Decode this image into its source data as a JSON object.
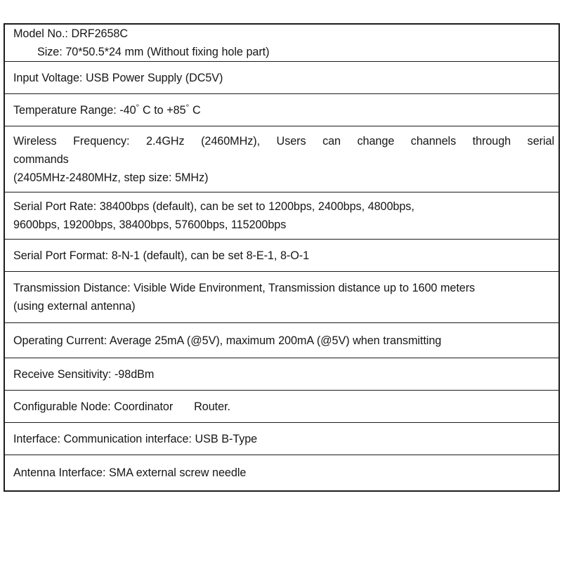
{
  "document": {
    "type": "specification-table",
    "title": "Wireless Module Specification",
    "background_color": "#ffffff",
    "text_color": "#161616",
    "border_color": "#1c1c1c",
    "row_count": 12
  },
  "table": {
    "rows": [
      {
        "key": "model-no",
        "label": "Model No.:",
        "value": "DRF2658C",
        "label2": "Size:",
        "value2": "70*50.5*24 mm (Without fixing hole part)",
        "line1_a": "Model No.: DRF2658C",
        "line1_b": "Size: 70*50.5*24 mm (Without fixing hole part)",
        "full_text": "Model No.: DRF2658C      Size: 70*50.5*24 mm (Without fixing hole part)"
      },
      {
        "key": "input-voltage",
        "label": "Input Voltage:",
        "value": "USB Power Supply (DC5V)",
        "line1": "Input Voltage: USB Power Supply (DC5V)",
        "full_text": "Input Voltage: USB Power Supply (DC5V)"
      },
      {
        "key": "temperature-range",
        "label": "Temperature Range:",
        "value": "-40° C to +85° C",
        "seg_a": "Temperature Range: -40",
        "seg_b": " C to +85",
        "seg_c": " C",
        "degree_symbol": "°",
        "full_text": "Temperature Range: -40° C to +85° C"
      },
      {
        "key": "wireless-frequency",
        "label": "Wireless Frequency:",
        "value": "2.4GHz (2460MHz), Users can change channels through serial commands (2405MHz-2480MHz, step size: 5MHz)",
        "line1": "Wireless Frequency: 2.4GHz (2460MHz), Users can change channels through serial",
        "line2": "commands",
        "line3": "(2405MHz-2480MHz, step size: 5MHz)",
        "full_text": "Wireless Frequency: 2.4GHz (2460MHz), Users can change channels through serial commands (2405MHz-2480MHz, step size: 5MHz)"
      },
      {
        "key": "serial-port-rate",
        "label": "Serial Port Rate:",
        "value": "38400bps (default), can be set to 1200bps, 2400bps, 4800bps, 9600bps, 19200bps, 38400bps, 57600bps, 115200bps",
        "line1": "Serial Port Rate: 38400bps (default), can be set to 1200bps, 2400bps, 4800bps,",
        "line2": "9600bps, 19200bps, 38400bps, 57600bps, 115200bps",
        "full_text": "Serial Port Rate: 38400bps (default), can be set to 1200bps, 2400bps, 4800bps, 9600bps, 19200bps, 38400bps, 57600bps, 115200bps"
      },
      {
        "key": "serial-port-format",
        "label": "Serial Port Format:",
        "value": "8-N-1 (default), can be set 8-E-1, 8-O-1",
        "line1": "Serial Port Format: 8-N-1 (default), can be set 8-E-1, 8-O-1",
        "full_text": "Serial Port Format: 8-N-1 (default), can be set 8-E-1, 8-O-1"
      },
      {
        "key": "transmission-distance",
        "label": "Transmission Distance:",
        "value": "Visible Wide Environment, Transmission distance up to 1600 meters (using external antenna)",
        "line1": "Transmission Distance: Visible Wide Environment, Transmission distance up to 1600 meters",
        "line2": "(using external antenna)",
        "full_text": "Transmission Distance: Visible Wide Environment, Transmission distance up to 1600 meters (using external antenna)"
      },
      {
        "key": "operating-current",
        "label": "Operating Current:",
        "value": "Average 25mA (@5V), maximum 200mA (@5V) when transmitting",
        "line1": "Operating Current: Average 25mA (@5V), maximum 200mA (@5V) when transmitting",
        "full_text": "Operating Current: Average 25mA (@5V), maximum 200mA (@5V) when transmitting"
      },
      {
        "key": "receive-sensitivity",
        "label": "Receive Sensitivity:",
        "value": "-98dBm",
        "line1": "Receive Sensitivity: -98dBm",
        "full_text": "Receive Sensitivity: -98dBm"
      },
      {
        "key": "configurable-node",
        "label": "Configurable Node:",
        "value": "Coordinator     Router.",
        "seg_a": "Configurable Node: Coordinator",
        "seg_b": "Router.",
        "full_text": "Configurable Node: Coordinator     Router."
      },
      {
        "key": "interface",
        "label": "Interface:",
        "value": "Communication interface: USB B-Type",
        "line1": "Interface: Communication interface: USB B-Type",
        "full_text": "Interface: Communication interface: USB B-Type"
      },
      {
        "key": "antenna-interface",
        "label": "Antenna Interface:",
        "value": "SMA external screw needle",
        "line1": "Antenna Interface: SMA external screw needle",
        "full_text": "Antenna Interface: SMA external screw needle"
      }
    ]
  }
}
